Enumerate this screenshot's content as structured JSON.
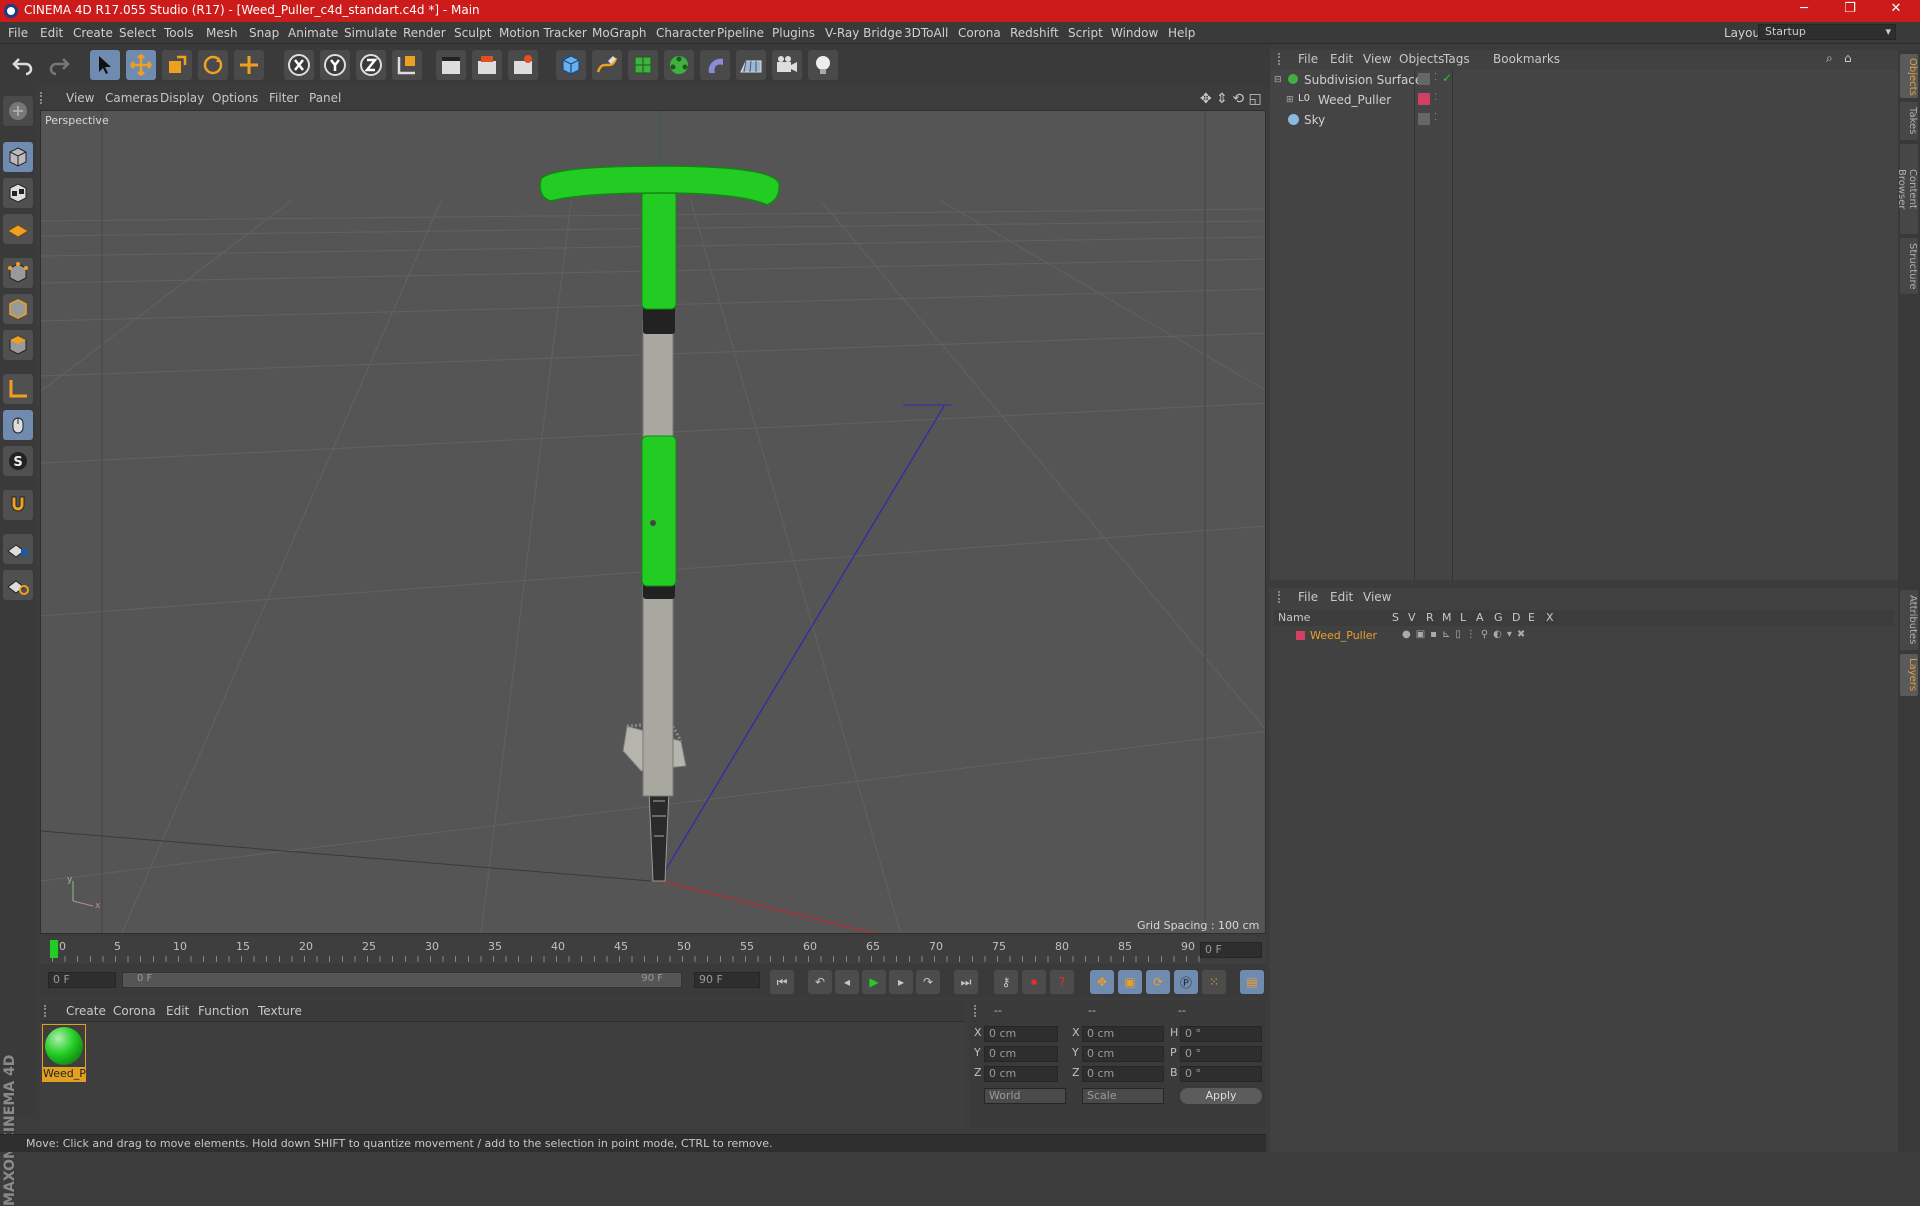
{
  "window": {
    "title": "CINEMA 4D R17.055 Studio (R17) - [Weed_Puller_c4d_standart.c4d *] - Main",
    "minimize": "─",
    "maximize": "❐",
    "close": "✕"
  },
  "menu": [
    "File",
    "Edit",
    "Create",
    "Select",
    "Tools",
    "Mesh",
    "Snap",
    "Animate",
    "Simulate",
    "Render",
    "Sculpt",
    "Motion Tracker",
    "MoGraph",
    "Character",
    "Pipeline",
    "Plugins",
    "V-Ray Bridge",
    "3DToAll",
    "Corona",
    "Redshift",
    "Script",
    "Window",
    "Help"
  ],
  "layout": {
    "label": "Layout:",
    "value": "Startup"
  },
  "viewport": {
    "menu": [
      "View",
      "Cameras",
      "Display",
      "Options",
      "Filter",
      "Panel"
    ],
    "label": "Perspective",
    "grid_spacing": "Grid Spacing : 100 cm",
    "axis": {
      "y": "y",
      "x": "x"
    }
  },
  "timeline": {
    "ticks": [
      "0",
      "5",
      "10",
      "15",
      "20",
      "25",
      "30",
      "35",
      "40",
      "45",
      "50",
      "55",
      "60",
      "65",
      "70",
      "75",
      "80",
      "85",
      "90"
    ],
    "current_frame": "0 F",
    "start": "0 F",
    "range_start": "0 F",
    "range_end": "90 F",
    "end": "90 F"
  },
  "material_menu": [
    "Create",
    "Corona",
    "Edit",
    "Function",
    "Texture"
  ],
  "material": {
    "name": "Weed_P"
  },
  "coords": {
    "header": [
      "--",
      "--",
      "--"
    ],
    "rows": [
      {
        "a": "X",
        "av": "0 cm",
        "b": "X",
        "bv": "0 cm",
        "c": "H",
        "cv": "0 °"
      },
      {
        "a": "Y",
        "av": "0 cm",
        "b": "Y",
        "bv": "0 cm",
        "c": "P",
        "cv": "0 °"
      },
      {
        "a": "Z",
        "av": "0 cm",
        "b": "Z",
        "bv": "0 cm",
        "c": "B",
        "cv": "0 °"
      }
    ],
    "mode1": "World",
    "mode2": "Scale",
    "apply": "Apply"
  },
  "status": "Move: Click and drag to move elements. Hold down SHIFT to quantize movement / add to the selection in point mode, CTRL to remove.",
  "objects_menu": [
    "File",
    "Edit",
    "View",
    "Objects",
    "Tags",
    "Bookmarks"
  ],
  "objects": [
    {
      "name": "Subdivision Surface"
    },
    {
      "name": "Weed_Puller"
    },
    {
      "name": "Sky"
    }
  ],
  "layers_menu": [
    "File",
    "Edit",
    "View"
  ],
  "layers_header": {
    "name": "Name",
    "cols": [
      "S",
      "V",
      "R",
      "M",
      "L",
      "A",
      "G",
      "D",
      "E",
      "X"
    ]
  },
  "layers": [
    {
      "name": "Weed_Puller"
    }
  ],
  "right_tabs": [
    "Objects",
    "Takes",
    "Content Browser",
    "Structure",
    "Attributes",
    "Layers"
  ],
  "brand": "MAXON CINEMA 4D",
  "colors": {
    "title_bar": "#cc1b1b",
    "accent_green": "#22cc22",
    "layer_name": "#e8a030",
    "layer_swatch": "#d04060"
  }
}
